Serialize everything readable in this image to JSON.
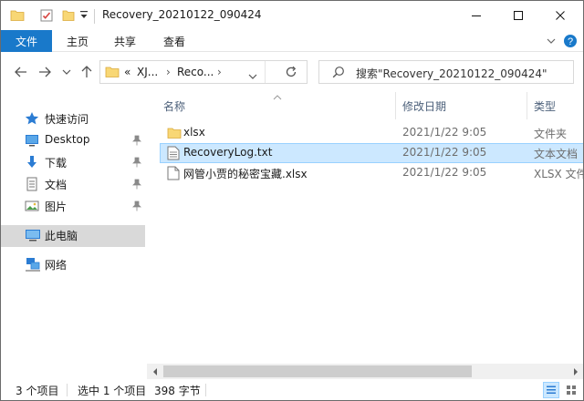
{
  "window": {
    "title": "Recovery_20210122_090424"
  },
  "ribbon": {
    "tabs": [
      {
        "label": "文件"
      },
      {
        "label": "主页"
      },
      {
        "label": "共享"
      },
      {
        "label": "查看"
      }
    ]
  },
  "navigation": {
    "breadcrumb": [
      "«",
      "XJ...",
      "Reco..."
    ],
    "search_placeholder": "搜索\"Recovery_20210122_090424\""
  },
  "sidebar": {
    "items": [
      {
        "label": "快速访问",
        "icon": "star-icon"
      },
      {
        "label": "Desktop",
        "icon": "desktop-icon",
        "pinned": true
      },
      {
        "label": "下载",
        "icon": "download-icon",
        "pinned": true
      },
      {
        "label": "文档",
        "icon": "document-icon",
        "pinned": true
      },
      {
        "label": "图片",
        "icon": "picture-icon",
        "pinned": true
      },
      {
        "label": "此电脑",
        "icon": "computer-icon",
        "selected": true
      },
      {
        "label": "网络",
        "icon": "network-icon"
      }
    ]
  },
  "file_list": {
    "columns": [
      "名称",
      "修改日期",
      "类型"
    ],
    "rows": [
      {
        "name": "xlsx",
        "date": "2021/1/22 9:05",
        "type": "文件夹",
        "icon": "folder-icon"
      },
      {
        "name": "RecoveryLog.txt",
        "date": "2021/1/22 9:05",
        "type": "文本文档",
        "icon": "text-file-icon",
        "selected": true
      },
      {
        "name": "网管小贾的秘密宝藏.xlsx",
        "date": "2021/1/22 9:05",
        "type": "XLSX 文件",
        "icon": "file-icon"
      }
    ]
  },
  "status": {
    "item_count": "3 个项目",
    "selection": "选中 1 个项目",
    "size": "398 字节"
  },
  "colors": {
    "accent": "#1979ca",
    "selection_bg": "#cce8ff",
    "selection_border": "#99d1ff",
    "folder": "#f8d775"
  }
}
